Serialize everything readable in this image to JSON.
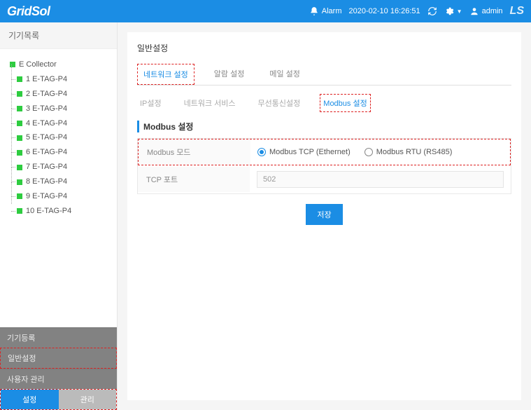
{
  "header": {
    "brand": "GridSol",
    "alarm": "Alarm",
    "datetime": "2020-02-10 16:26:51",
    "user": "admin",
    "ls": "LS"
  },
  "sidebar": {
    "title": "기기목록",
    "tree": {
      "root": "E Collector",
      "children": [
        "1 E-TAG-P4",
        "2 E-TAG-P4",
        "3 E-TAG-P4",
        "4 E-TAG-P4",
        "5 E-TAG-P4",
        "6 E-TAG-P4",
        "7 E-TAG-P4",
        "8 E-TAG-P4",
        "9 E-TAG-P4",
        "10 E-TAG-P4"
      ]
    },
    "bottom_items": [
      "기기등록",
      "일반설정",
      "사용자 관리"
    ],
    "tabs": {
      "active": "설정",
      "inactive": "관리"
    }
  },
  "content": {
    "panel_title": "일반설정",
    "tabs1": [
      "네트워크 설정",
      "알람 설정",
      "메일 설정"
    ],
    "tabs2": [
      "IP설정",
      "네트워크 서비스",
      "무선통신설정",
      "Modbus 설정"
    ],
    "section": "Modbus 설정",
    "form": {
      "mode_label": "Modbus 모드",
      "mode_options": [
        "Modbus TCP (Ethernet)",
        "Modbus RTU (RS485)"
      ],
      "port_label": "TCP 포트",
      "port_value": "502"
    },
    "save": "저장"
  }
}
